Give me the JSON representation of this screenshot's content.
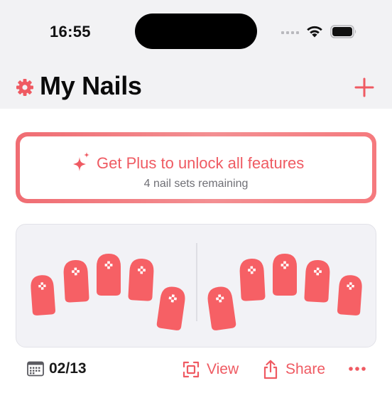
{
  "status_bar": {
    "time": "16:55"
  },
  "header": {
    "title": "My Nails",
    "settings_icon": "gear-icon",
    "add_icon": "plus-icon"
  },
  "promo": {
    "title": "Get Plus to unlock all features",
    "subtitle": "4 nail sets remaining",
    "icon": "sparkle-icon"
  },
  "nail_set": {
    "date": "02/13",
    "view_label": "View",
    "share_label": "Share",
    "nail_color": "#f66065"
  },
  "colors": {
    "accent": "#ef5a62",
    "background_top": "#f2f2f4"
  }
}
